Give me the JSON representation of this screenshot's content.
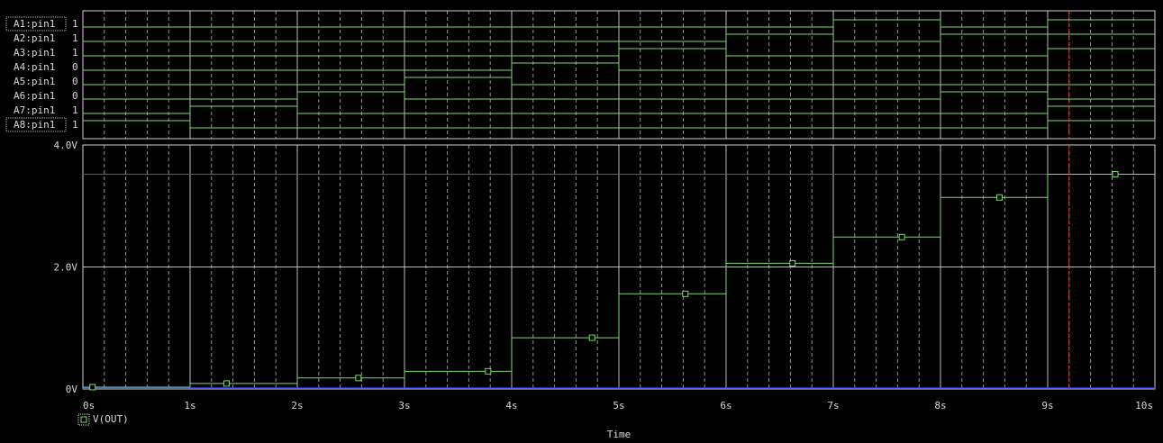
{
  "chart_data": {
    "type": "line",
    "digital": {
      "signals": [
        {
          "name": "A1:pin1",
          "value": "1"
        },
        {
          "name": "A2:pin1",
          "value": "1"
        },
        {
          "name": "A3:pin1",
          "value": "1"
        },
        {
          "name": "A4:pin1",
          "value": "0"
        },
        {
          "name": "A5:pin1",
          "value": "0"
        },
        {
          "name": "A6:pin1",
          "value": "0"
        },
        {
          "name": "A7:pin1",
          "value": "1"
        },
        {
          "name": "A8:pin1",
          "value": "1"
        }
      ],
      "states": [
        [
          0,
          0,
          0,
          0,
          0,
          0,
          0,
          1
        ],
        [
          0,
          0,
          0,
          0,
          0,
          0,
          1,
          0
        ],
        [
          0,
          0,
          0,
          0,
          0,
          1,
          0,
          0
        ],
        [
          0,
          0,
          0,
          0,
          1,
          0,
          0,
          0
        ],
        [
          0,
          0,
          0,
          1,
          0,
          0,
          0,
          0
        ],
        [
          0,
          0,
          1,
          0,
          0,
          0,
          0,
          0
        ],
        [
          0,
          1,
          0,
          0,
          0,
          0,
          0,
          0
        ],
        [
          1,
          0,
          0,
          0,
          0,
          0,
          0,
          0
        ],
        [
          0,
          1,
          0,
          0,
          0,
          1,
          0,
          0
        ],
        [
          1,
          1,
          1,
          0,
          0,
          0,
          1,
          1
        ]
      ]
    },
    "analog": {
      "xlabel": "Time",
      "x_ticks": [
        "0s",
        "1s",
        "2s",
        "3s",
        "4s",
        "5s",
        "6s",
        "7s",
        "8s",
        "9s",
        "10s"
      ],
      "y_ticks": [
        {
          "v": 0,
          "label": "0V"
        },
        {
          "v": 2.0,
          "label": "2.0V"
        },
        {
          "v": 4.0,
          "label": "4.0V"
        }
      ],
      "xlim": [
        0,
        10
      ],
      "ylim": [
        0,
        4.0
      ],
      "series": [
        {
          "name": "V(OUT)",
          "color": "#7bdc6b",
          "x": [
            0,
            1,
            2,
            3,
            4,
            5,
            6,
            7,
            8,
            9,
            10
          ],
          "values": [
            0.03,
            0.09,
            0.18,
            0.29,
            0.84,
            1.56,
            2.06,
            2.49,
            3.14,
            3.52
          ]
        }
      ],
      "reference_level": 3.52,
      "cursor_x": 9.2
    },
    "grid": true,
    "colors": {
      "trace": "#7bdc6b",
      "cursor": "#e0322a",
      "reference": "#c83228",
      "baseline": "#2a3cff",
      "grid": "#d0d0d0"
    }
  }
}
